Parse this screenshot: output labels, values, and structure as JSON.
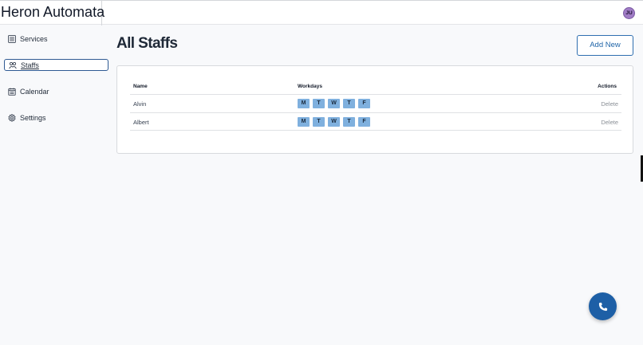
{
  "header": {
    "brand": "Heron Automata",
    "avatar_initials": "JU"
  },
  "sidebar": {
    "items": [
      {
        "label": "Services",
        "icon": "list-icon",
        "active": false
      },
      {
        "label": "Staffs",
        "icon": "people-icon",
        "active": true
      },
      {
        "label": "Calendar",
        "icon": "calendar-icon",
        "active": false
      },
      {
        "label": "Settings",
        "icon": "gear-icon",
        "active": false
      }
    ]
  },
  "main": {
    "title": "All Staffs",
    "add_button": "Add New",
    "table": {
      "columns": [
        "Name",
        "Workdays",
        "Actions"
      ],
      "rows": [
        {
          "name": "Alvin",
          "days": [
            "M",
            "T",
            "W",
            "T",
            "F"
          ],
          "action": "Delete"
        },
        {
          "name": "Albert",
          "days": [
            "M",
            "T",
            "W",
            "T",
            "F"
          ],
          "action": "Delete"
        }
      ]
    }
  },
  "fab": {
    "icon": "phone-icon"
  },
  "colors": {
    "accent": "#1d5fa6",
    "day_chip": "#7fb0de",
    "avatar": "#a07cc5"
  }
}
